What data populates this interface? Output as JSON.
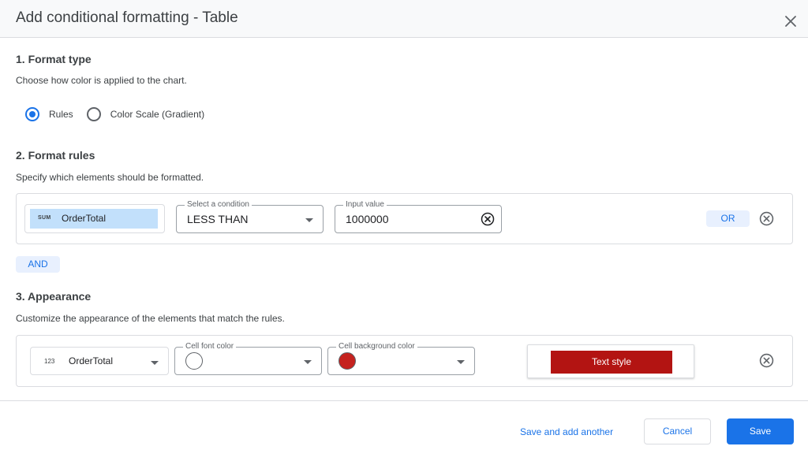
{
  "dialog": {
    "title": "Add conditional formatting - Table"
  },
  "section1": {
    "title": "1. Format type",
    "description": "Choose how color is applied to the chart.",
    "options": [
      {
        "label": "Rules",
        "checked": true
      },
      {
        "label": "Color Scale (Gradient)",
        "checked": false
      }
    ]
  },
  "section2": {
    "title": "2. Format rules",
    "description": "Specify which elements should be formatted.",
    "rule": {
      "field_type": "SUM",
      "field_name": "OrderTotal",
      "condition_label": "Select a condition",
      "condition_value": "LESS THAN",
      "input_label": "Input value",
      "input_value": "1000000",
      "or_label": "OR"
    },
    "and_label": "AND"
  },
  "section3": {
    "title": "3. Appearance",
    "description": "Customize the appearance of the elements that match the rules.",
    "field_type": "123",
    "field_name": "OrderTotal",
    "font_color_label": "Cell font color",
    "font_color": "#ffffff",
    "bg_color_label": "Cell background color",
    "bg_color": "#c5221f",
    "text_style_label": "Text style",
    "text_style_bg": "#b31412"
  },
  "footer": {
    "save_and_add_label": "Save and add another",
    "cancel_label": "Cancel",
    "save_label": "Save"
  },
  "colors": {
    "accent": "#1a73e8"
  }
}
